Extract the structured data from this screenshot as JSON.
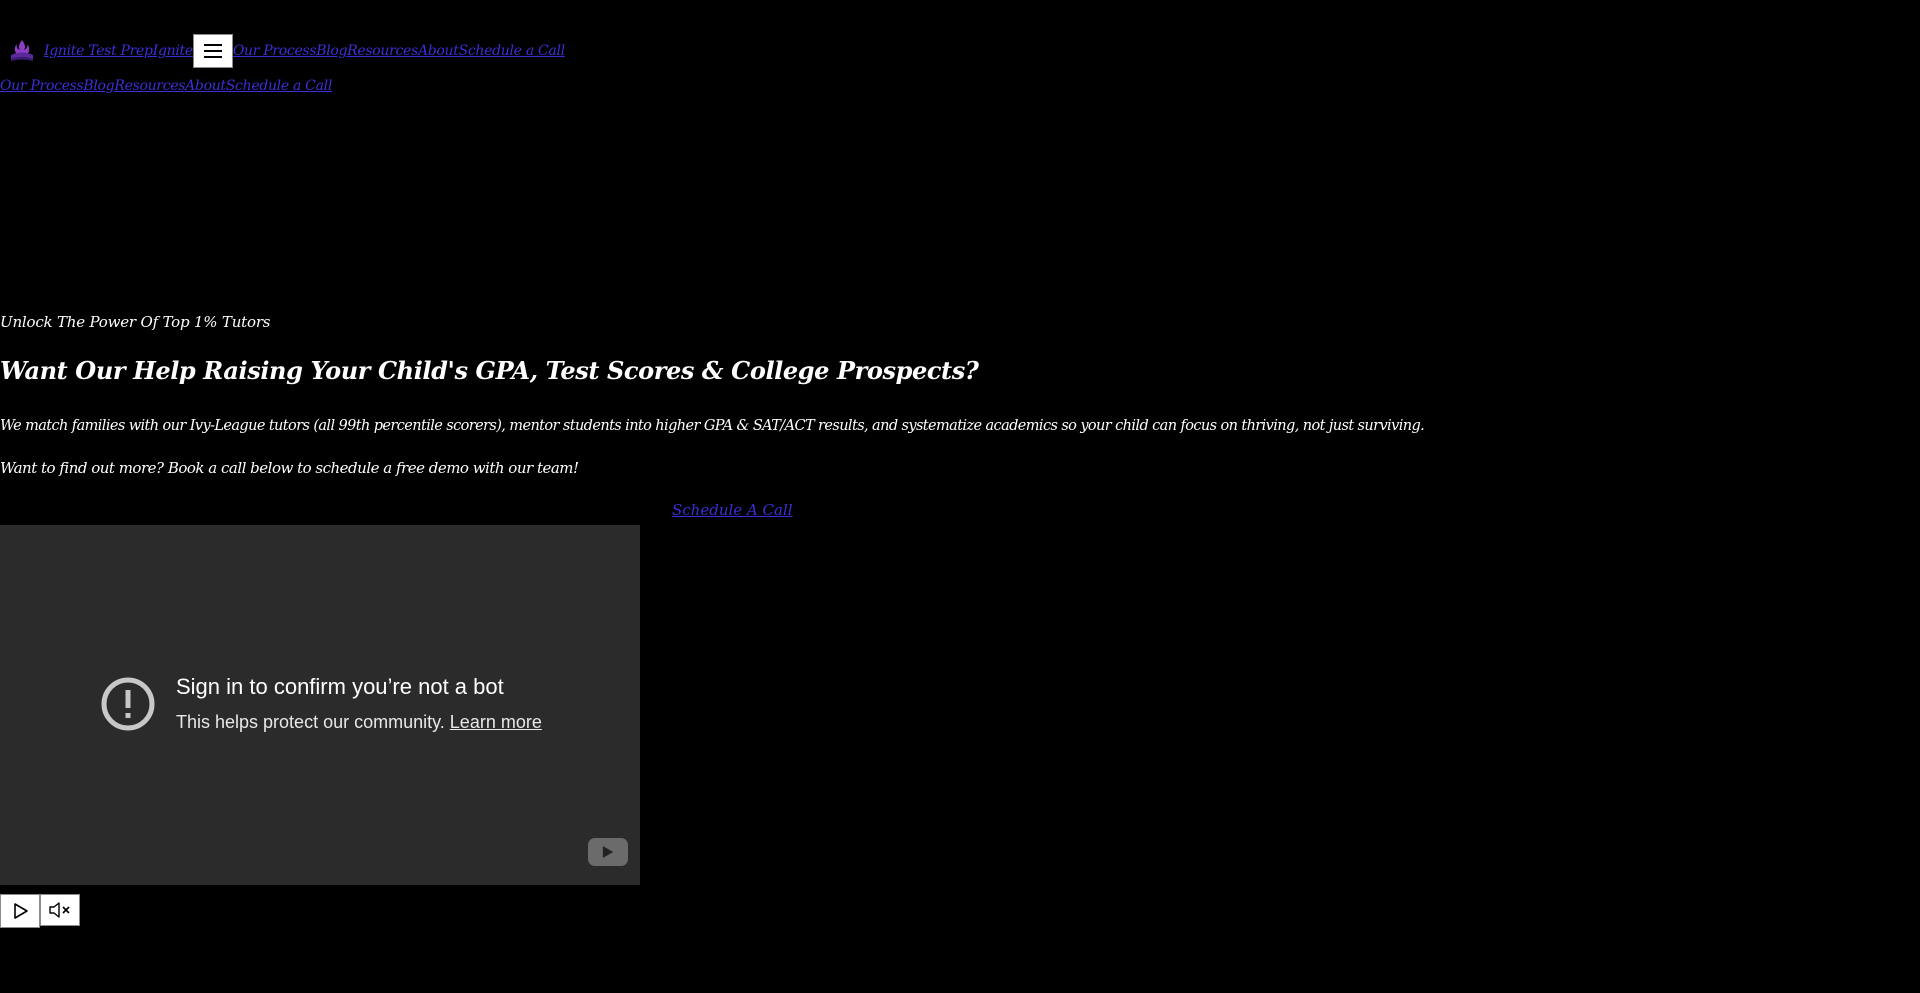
{
  "header": {
    "logo_icon": "ignite-logo-icon",
    "brand_name": "Ignite Test Prep",
    "brand_short": "Ignite",
    "menu_icon": "hamburger-menu-icon",
    "nav": [
      "Our Process",
      "Blog",
      "Resources",
      "About",
      "Schedule a Call"
    ]
  },
  "mobile_nav": [
    "Our Process",
    "Blog",
    "Resources",
    "About",
    "Schedule a Call"
  ],
  "hero": {
    "eyebrow": "Unlock The Power Of Top 1% Tutors",
    "headline": "Want Our Help Raising Your Child's GPA, Test Scores & College Prospects?",
    "description": "We match families with our Ivy-League tutors (all 99th percentile scorers), mentor students into higher GPA & SAT/ACT results, and systematize academics so your child can focus on thriving, not just surviving.",
    "cta_text": "Want to find out more? Book a call below to schedule a free demo with our team!",
    "cta_link": "Schedule A Call"
  },
  "video": {
    "title": "Sign in to confirm you’re not a bot",
    "subtitle": "This helps protect our community.",
    "learn_more": "Learn more",
    "alert_icon": "exclamation-circle-icon",
    "youtube_icon": "youtube-play-icon"
  },
  "controls": {
    "play_icon": "play-icon",
    "mute_icon": "muted-speaker-icon"
  },
  "colors": {
    "background": "#000000",
    "link": "#3b2fd6",
    "text": "#ffffff",
    "video_bg": "#2b2b2b"
  }
}
